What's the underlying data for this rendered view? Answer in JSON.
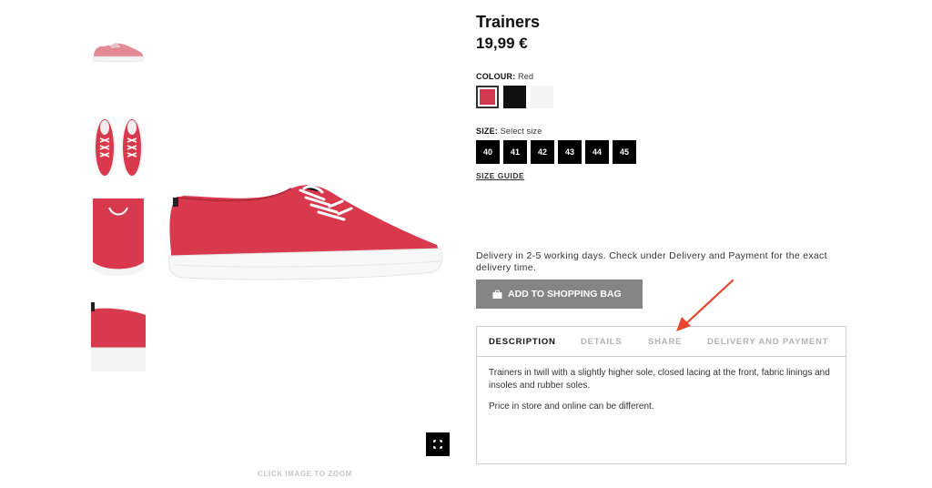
{
  "product": {
    "title": "Trainers",
    "price": "19,99 €"
  },
  "colour": {
    "label": "COLOUR:",
    "selected": "Red",
    "swatches": [
      {
        "name": "Red",
        "hex": "#d2384f"
      },
      {
        "name": "Black",
        "hex": "#111111"
      },
      {
        "name": "White",
        "hex": "#f4f4f4"
      }
    ]
  },
  "size": {
    "label": "SIZE:",
    "placeholder": "Select size",
    "options": [
      "40",
      "41",
      "42",
      "43",
      "44",
      "45"
    ],
    "guide_label": "SIZE GUIDE"
  },
  "delivery": {
    "text": "Delivery in 2-5 working days. Check under Delivery and Payment for the exact delivery time."
  },
  "cart": {
    "button_label": "ADD TO SHOPPING BAG",
    "button_color": "#858585"
  },
  "tabs": {
    "items": [
      {
        "label": "DESCRIPTION"
      },
      {
        "label": "DETAILS"
      },
      {
        "label": "SHARE"
      },
      {
        "label": "DELIVERY AND PAYMENT"
      }
    ],
    "description": {
      "paragraph_1": "Trainers in twill with a slightly higher sole, closed lacing at the front, fabric linings and insoles and rubber soles.",
      "paragraph_2": "Price in store and online can be different."
    }
  },
  "gallery": {
    "zoom_hint": "CLICK IMAGE TO ZOOM",
    "zoom_icon": "fullscreen-icon",
    "shoe_color": "#d9394c"
  },
  "annotation": {
    "arrow_color": "#e8452c"
  }
}
